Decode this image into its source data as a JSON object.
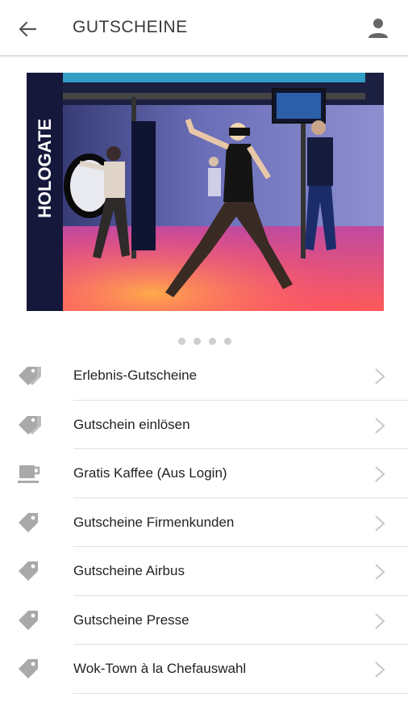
{
  "header": {
    "title": "GUTSCHEINE",
    "back_icon": "arrow-left-icon",
    "profile_icon": "person-icon"
  },
  "banner": {
    "description_icon": "vr-arena-photo",
    "brand_text": "HOLOGATE",
    "page_count": 4,
    "active_page": 1
  },
  "menu": {
    "items": [
      {
        "label": "Erlebnis-Gutscheine",
        "icon": "tags-icon"
      },
      {
        "label": "Gutschein einlösen",
        "icon": "tags-icon"
      },
      {
        "label": "Gratis Kaffee (Aus Login)",
        "icon": "coffee-cup-icon"
      },
      {
        "label": "Gutscheine Firmenkunden",
        "icon": "tag-icon"
      },
      {
        "label": "Gutscheine Airbus",
        "icon": "tag-icon"
      },
      {
        "label": "Gutscheine Presse",
        "icon": "tag-icon"
      },
      {
        "label": "Wok-Town à la Chefauswahl",
        "icon": "tag-icon"
      }
    ]
  },
  "colors": {
    "icon_gray": "#bdbdbd",
    "chevron_gray": "#c8c8c8",
    "divider": "#e2e2e2"
  }
}
